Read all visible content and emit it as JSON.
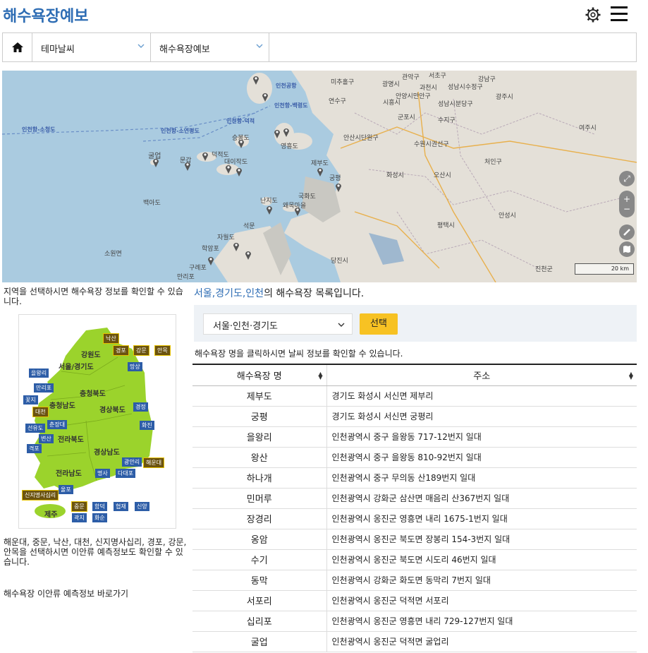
{
  "header": {
    "title": "해수욕장예보",
    "settings_icon": "gear-icon",
    "menu_icon": "hamburger-menu-icon"
  },
  "breadcrumb": {
    "home_icon": "home-icon",
    "category": "테마날씨",
    "page": "해수욕장예보"
  },
  "map": {
    "place_labels": [
      "관악구",
      "서초구",
      "강남구",
      "과천시",
      "성남시수정구",
      "미추홀구",
      "연수구",
      "광명시",
      "시흥시",
      "안양시만안구",
      "성남시분당구",
      "광주시",
      "군포시",
      "수지구",
      "안산시단원구",
      "수원시권선구",
      "화성시",
      "오산시",
      "처인구",
      "여주시",
      "평택시",
      "안성시",
      "당진시",
      "진천군",
      "인천공항",
      "영흥도",
      "굴업",
      "문갑",
      "덕적도",
      "백아도",
      "제부도",
      "궁평",
      "국화도",
      "왜목마을",
      "난지도",
      "석문",
      "자월도",
      "승봉도",
      "대이작도",
      "학암포",
      "구례포",
      "소원면",
      "만리포"
    ],
    "sea_labels": [
      "인천항-소청도",
      "인천항-소연평도",
      "인천항-덕적",
      "인천항-백령도"
    ],
    "scale_label": "20 km",
    "accent": "#2e6db4"
  },
  "left": {
    "intro": "지역을 선택하시면 해수욕장 정보를 확인할 수 있습니다.",
    "regions": [
      "강원도",
      "서울/경기도",
      "충청북도",
      "충청남도",
      "경상북도",
      "전라북도",
      "경상남도",
      "전라남도",
      "제주"
    ],
    "tags_blue": [
      "을왕리",
      "만리포",
      "꽃지",
      "선유도",
      "변산",
      "격포",
      "춘장대",
      "망상",
      "경정",
      "화진",
      "광안리",
      "다대포",
      "명사",
      "울포",
      "함덕",
      "협재",
      "신양",
      "곽지",
      "화순"
    ],
    "tags_yellow": [
      "낙산",
      "경포",
      "강문",
      "안목",
      "대천",
      "해운대",
      "신지명사십리",
      "중문"
    ],
    "note": "해운대, 중문, 낙산, 대천, 신지명사십리, 경포, 강문, 안목을 선택하시면 이안류 예측정보도 확인할 수 있습니다.",
    "link": "해수욕장 이안류 예측정보 바로가기"
  },
  "list": {
    "title_highlight": "서울,경기도,인천",
    "title_rest": "의 해수욕장 목록입니다.",
    "region_select": "서울·인천·경기도",
    "select_button": "선택",
    "hint": "해수욕장 명을 클릭하시면 날씨 정보를 확인할 수 있습니다.",
    "columns": [
      "해수욕장 명",
      "주소"
    ],
    "rows": [
      {
        "name": "제부도",
        "addr": "경기도 화성시 서신면 제부리"
      },
      {
        "name": "궁평",
        "addr": "경기도 화성시 서신면 궁평리"
      },
      {
        "name": "을왕리",
        "addr": "인천광역시 중구 을왕동 717-12번지 일대"
      },
      {
        "name": "왕산",
        "addr": "인천광역시 중구 을왕동 810-92번지 일대"
      },
      {
        "name": "하나개",
        "addr": "인천광역시 중구 무의동 산189번지 일대"
      },
      {
        "name": "민머루",
        "addr": "인천광역시 강화군 삼산면 매음리 산367번지 일대"
      },
      {
        "name": "장경리",
        "addr": "인천광역시 옹진군 영흥면 내리 1675-1번지 일대"
      },
      {
        "name": "옹암",
        "addr": "인천광역시 옹진군 북도면 장봉리 154-3번지 일대"
      },
      {
        "name": "수기",
        "addr": "인천광역시 옹진군 북도면 시도리 46번지 일대"
      },
      {
        "name": "동막",
        "addr": "인천광역시 강화군 화도면 동막리 7번지 일대"
      },
      {
        "name": "서포리",
        "addr": "인천광역시 옹진군 덕적면 서포리"
      },
      {
        "name": "십리포",
        "addr": "인천광역시 옹진군 영흥면 내리 729-127번지 일대"
      },
      {
        "name": "굴업",
        "addr": "인천광역시 옹진군 덕적면 굴업리"
      }
    ]
  }
}
